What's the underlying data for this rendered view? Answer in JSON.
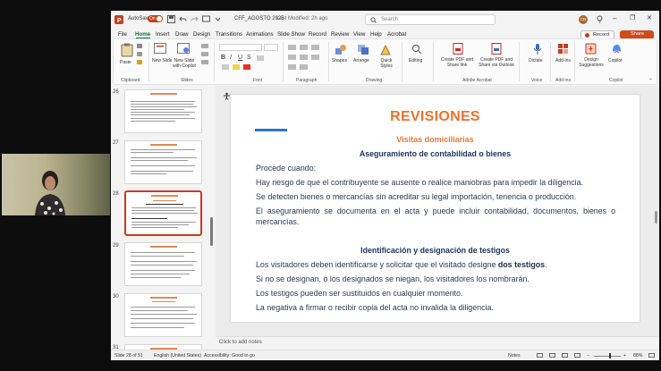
{
  "titlebar": {
    "autosave_label": "AutoSave",
    "autosave_state": "On",
    "filename": "CFF_AGOSTO 2025",
    "modified": "Last Modified: 2h ago",
    "search_placeholder": "Search",
    "user_initials": "CN"
  },
  "menu": [
    "File",
    "Home",
    "Insert",
    "Draw",
    "Design",
    "Transitions",
    "Animations",
    "Slide Show",
    "Record",
    "Review",
    "View",
    "Help",
    "Acrobat"
  ],
  "menu_active": "Home",
  "record_label": "Record",
  "share_label": "Share",
  "ribbon": {
    "paste": "Paste",
    "new_slide": "New Slide",
    "new_slide_copilot": "New Slide with Copilot",
    "shapes": "Shapes",
    "arrange": "Arrange",
    "quick_styles": "Quick Styles",
    "editing": "Editing",
    "create_pdf_link": "Create PDF and Share link",
    "create_pdf_outlook": "Create PDF and Share via Outlook",
    "dictate": "Dictate",
    "addins": "Add-ins",
    "design_suggestions": "Design Suggestions",
    "copilot": "Copilot",
    "groups": [
      "Clipboard",
      "Slides",
      "Font",
      "Paragraph",
      "Drawing",
      "Adobe Acrobat",
      "Voice",
      "Add-ins",
      "Copilot"
    ]
  },
  "thumbnails": [
    {
      "num": "26",
      "selected": false
    },
    {
      "num": "27",
      "selected": false
    },
    {
      "num": "28",
      "selected": true
    },
    {
      "num": "29",
      "selected": false
    },
    {
      "num": "30",
      "selected": false
    },
    {
      "num": "31",
      "selected": false
    }
  ],
  "slide": {
    "title": "REVISIONES",
    "subtitle": "Visitas domiciliarias",
    "heading1": "Aseguramiento de contabilidad o bienes",
    "lines1": [
      "Procede cuando:",
      "Hay riesgo de que el contribuyente se ausente o realice maniobras para impedir la diligencia.",
      "Se detecten bienes o mercancías sin acreditar su legal importación, tenencia o producción.",
      "El aseguramiento se documenta en el acta y puede incluir contabilidad, documentos, bienes o mercancías."
    ],
    "heading2": "Identificación y designación de testigos",
    "line2a_pre": "Los visitadores deben identificarse y solicitar que el visitado designe ",
    "line2a_bold": "dos testigos",
    "line2a_post": ".",
    "lines2": [
      "Si no se designan, o los designados se niegan, los visitadores los nombrarán.",
      "Los testigos pueden ser sustituidos en cualquier momento.",
      "La negativa a firmar o recibir copia del acta no invalida la diligencia."
    ]
  },
  "notes_placeholder": "Click to add notes",
  "status": {
    "slide_of": "Slide 28 of 51",
    "language": "English (United States)",
    "accessibility": "Accessibility: Good to go",
    "notes": "Notes",
    "zoom": "88%"
  }
}
